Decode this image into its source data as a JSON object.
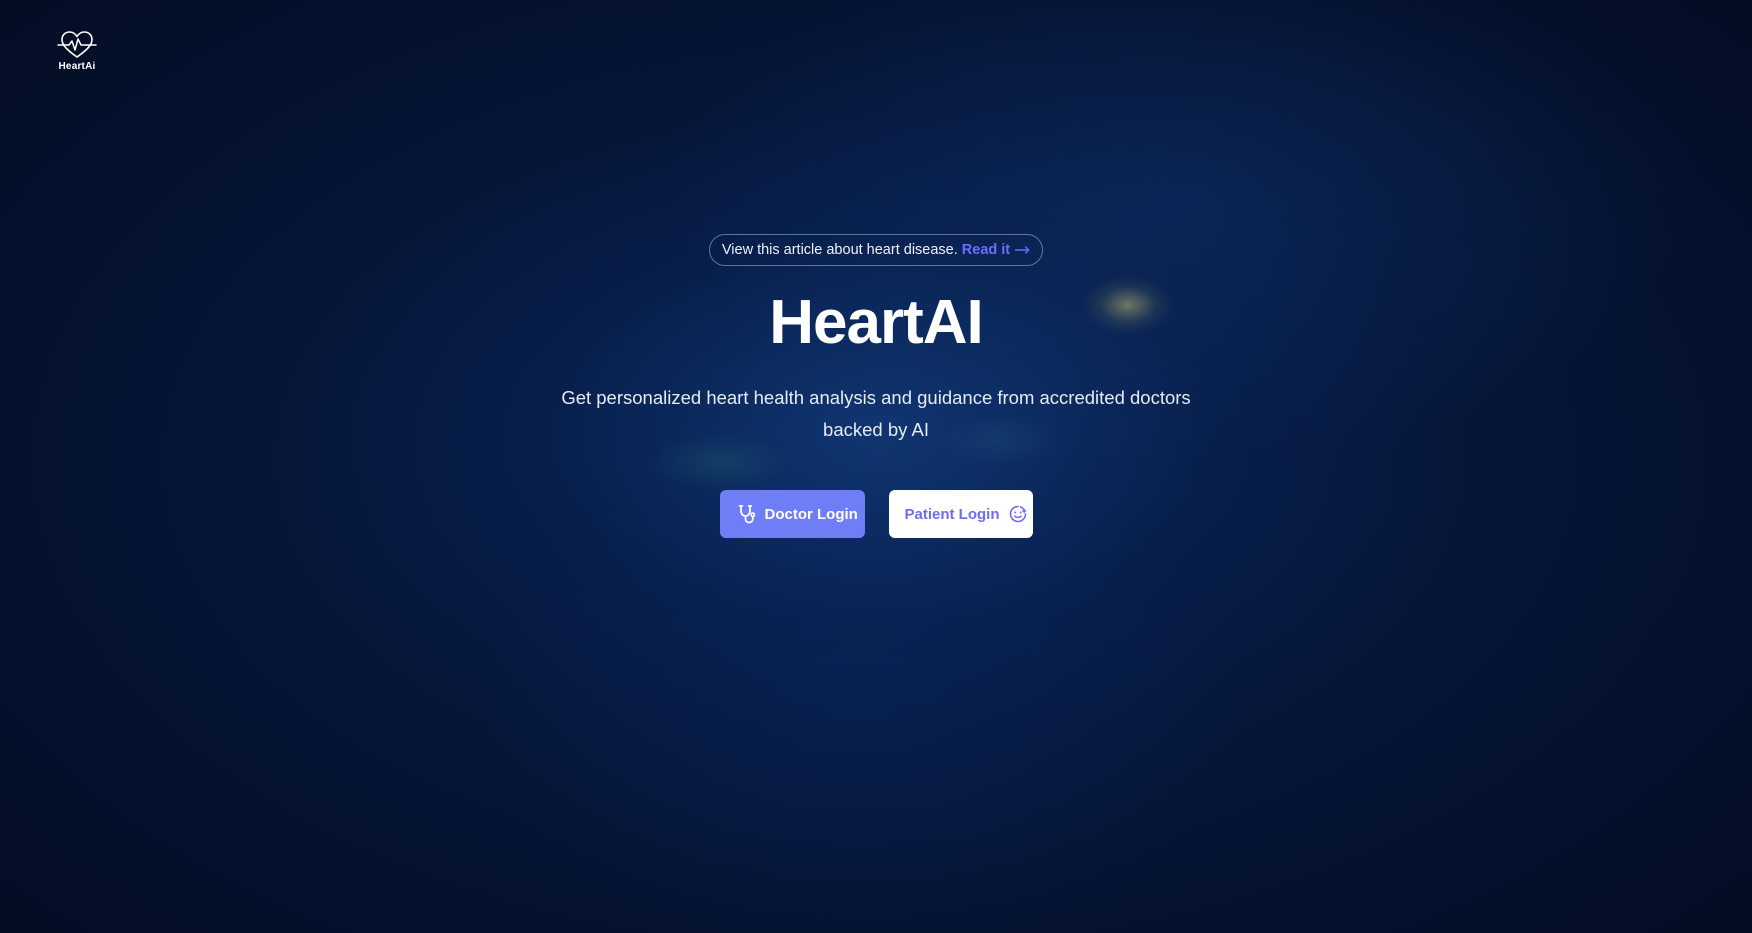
{
  "logo": {
    "icon": "heart-pulse-icon",
    "text": "HeartAi"
  },
  "announcement": {
    "text": "View this article about heart disease.",
    "link_label": "Read it",
    "link_icon": "arrow-right-icon"
  },
  "hero": {
    "title": "HeartAI",
    "subtitle": "Get personalized heart health analysis and guidance from accredited doctors backed by AI"
  },
  "buttons": {
    "doctor": {
      "label": "Doctor Login",
      "icon": "stethoscope-icon"
    },
    "patient": {
      "label": "Patient Login",
      "icon": "patient-face-icon"
    }
  },
  "colors": {
    "background": "#040f2a",
    "accent": "#6f7df7",
    "link": "#6d6cff",
    "text": "#ffffff"
  }
}
